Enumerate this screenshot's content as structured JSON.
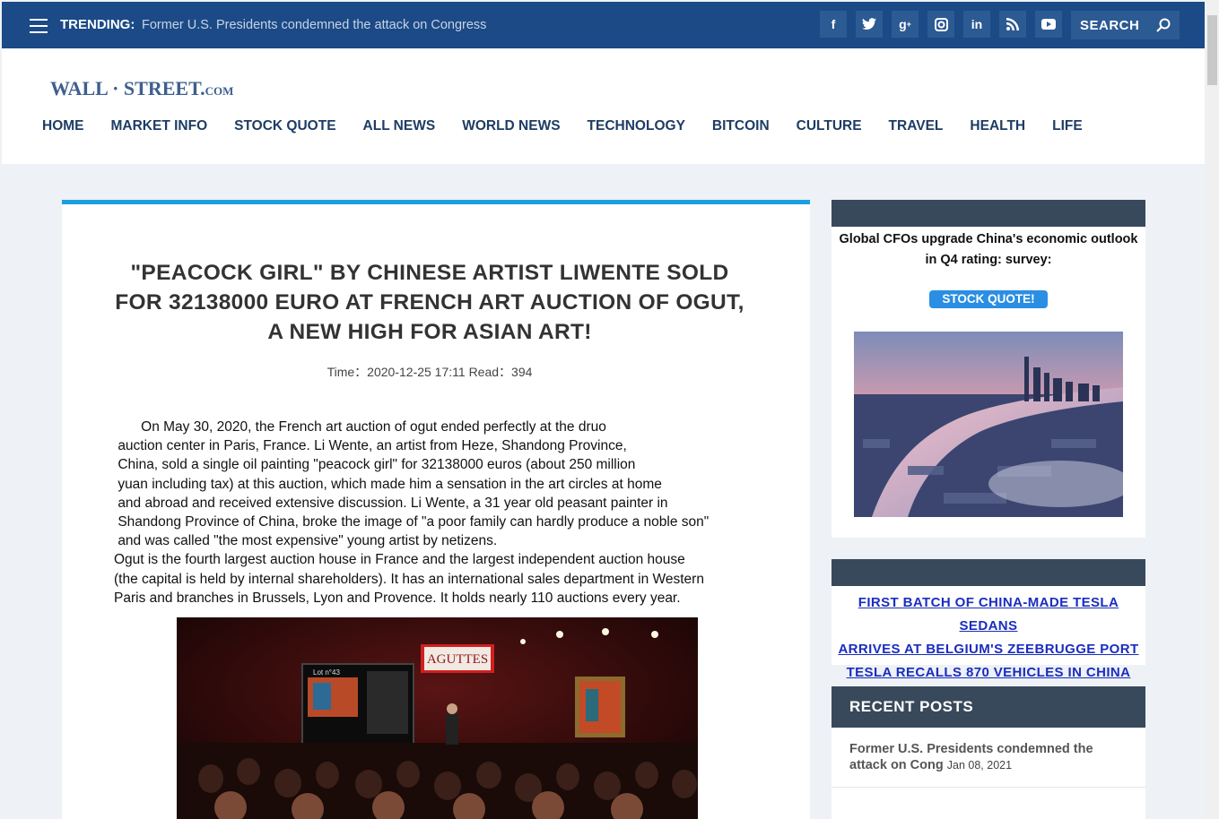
{
  "topbar": {
    "trending_label": "TRENDING:",
    "trending_text": "Former U.S. Presidents condemned the attack on Congress",
    "social_icons": [
      "facebook-icon",
      "twitter-icon",
      "google-plus-icon",
      "instagram-icon",
      "linkedin-icon",
      "rss-icon",
      "youtube-icon"
    ],
    "search_label": "SEARCH"
  },
  "header": {
    "logo_main": "WALL · STREET.",
    "logo_suffix": "COM",
    "nav": [
      "HOME",
      "MARKET INFO",
      "STOCK QUOTE",
      "ALL NEWS",
      "WORLD NEWS",
      "TECHNOLOGY",
      "BITCOIN",
      "CULTURE",
      "TRAVEL",
      "HEALTH",
      "LIFE"
    ]
  },
  "article": {
    "title_line1": "\"PEACOCK GIRL\" BY CHINESE ARTIST LIWENTE SOLD",
    "title_line2": "FOR 32138000 EURO AT FRENCH ART AUCTION OF OGUT,",
    "title_line3": "A NEW HIGH FOR ASIAN ART!",
    "meta": "Time：2020-12-25 17:11 Read：394",
    "lines": [
      "       On May 30, 2020, the French art auction of ogut ended perfectly at the druo",
      " auction center in Paris, France. Li Wente, an artist from Heze, Shandong Province,",
      " China, sold a single oil painting \"peacock girl\" for 32138000 euros (about 250 million",
      " yuan including tax) at this auction, which made him a sensation in the art circles at home",
      " and abroad and received extensive discussion. Li Wente, a 31 year old peasant painter in",
      " Shandong Province of China, broke the image of \"a poor family can hardly produce a noble son\"",
      " and was called \"the most expensive\" young artist by netizens.",
      "Ogut is the fourth largest auction house in France and the largest independent auction house",
      "(the capital is held by internal shareholders). It has an international sales department in Western",
      "Paris and branches in Brussels, Lyon and Provence. It holds nearly 110 auctions every year."
    ],
    "photo_sign": "AGUTTES",
    "photo_screen_lot": "Lot n°43"
  },
  "sidebar": {
    "card1_text": "Global CFOs upgrade China's economic outlook in Q4 rating: survey:",
    "card1_button": "STOCK QUOTE!",
    "card2_links": [
      "FIRST BATCH OF CHINA-MADE TESLA SEDANS",
      "ARRIVES AT BELGIUM'S ZEEBRUGGE PORT",
      "TESLA RECALLS 870 VEHICLES IN CHINA"
    ],
    "recent_title": "RECENT POSTS",
    "recent_posts": [
      {
        "title": "Former U.S. Presidents condemned the attack on Cong",
        "date": "Jan 08, 2021"
      }
    ]
  },
  "colors": {
    "topbar": "#1b4a86",
    "accent": "#1aa0e0",
    "nav_text": "#1e3c64",
    "widget_head": "#39495c",
    "button": "#2a8ee3",
    "link": "#1a2dbf"
  }
}
